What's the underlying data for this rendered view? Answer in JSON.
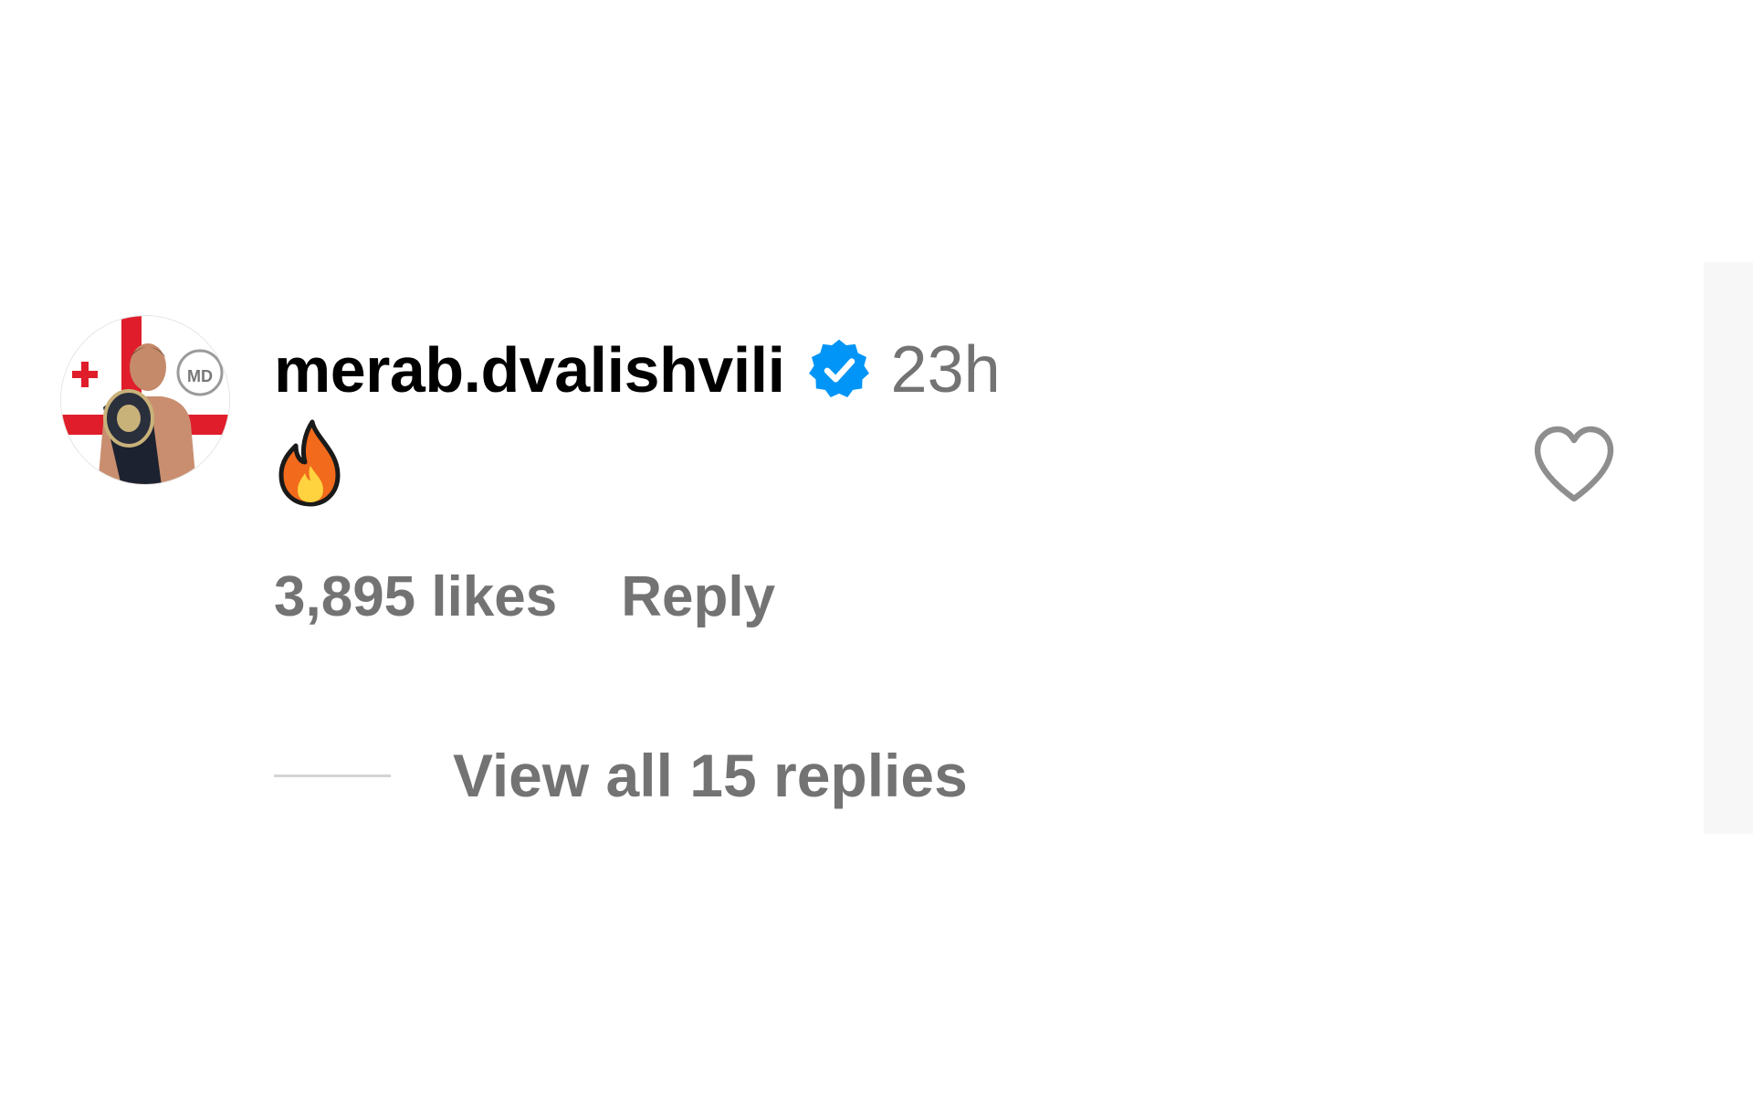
{
  "comment": {
    "username": "merab.dvalishvili",
    "verified": true,
    "timestamp": "23h",
    "body_icon": "fire-emoji-icon",
    "likes_text": "3,895 likes",
    "reply_label": "Reply",
    "view_replies_label": "View all 15 replies",
    "like_icon": "heart-outline-icon",
    "avatar_icon": "profile-avatar"
  },
  "colors": {
    "primary_text": "#000000",
    "secondary_text": "#737373",
    "verified_badge": "#0095f6",
    "divider": "#d4d4d4"
  }
}
